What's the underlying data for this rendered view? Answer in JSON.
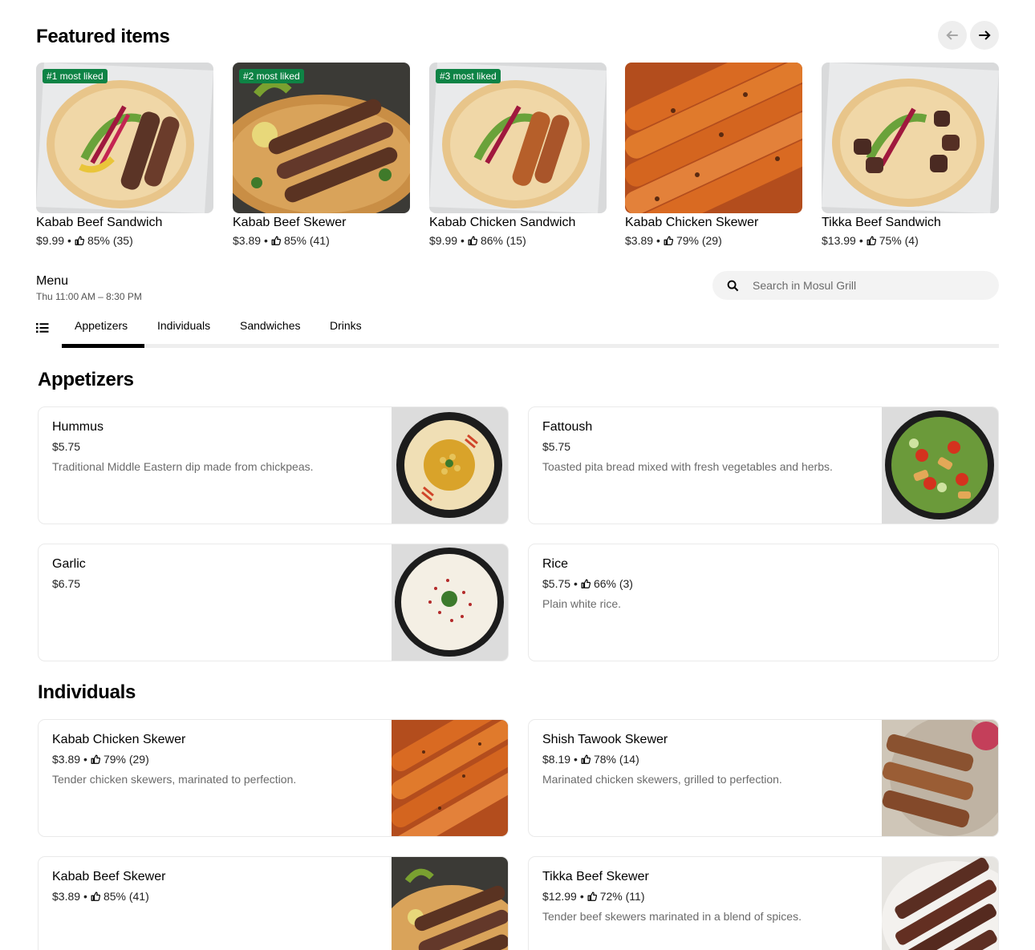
{
  "featured": {
    "title": "Featured items",
    "items": [
      {
        "badge": "#1 most liked",
        "name": "Kabab Beef Sandwich",
        "price": "$9.99",
        "rating": "85% (35)"
      },
      {
        "badge": "#2 most liked",
        "name": "Kabab Beef Skewer",
        "price": "$3.89",
        "rating": "85% (41)"
      },
      {
        "badge": "#3 most liked",
        "name": "Kabab Chicken Sandwich",
        "price": "$9.99",
        "rating": "86% (15)"
      },
      {
        "badge": "",
        "name": "Kabab Chicken Skewer",
        "price": "$3.89",
        "rating": "79% (29)"
      },
      {
        "badge": "",
        "name": "Tikka Beef Sandwich",
        "price": "$13.99",
        "rating": "75% (4)"
      }
    ]
  },
  "menu": {
    "title": "Menu",
    "hours": "Thu 11:00 AM – 8:30 PM"
  },
  "search": {
    "placeholder": "Search in Mosul Grill"
  },
  "tabs": [
    "Appetizers",
    "Individuals",
    "Sandwiches",
    "Drinks"
  ],
  "sections": {
    "appetizers": {
      "title": "Appetizers",
      "items": [
        {
          "name": "Hummus",
          "price": "$5.75",
          "rating": "",
          "desc": "Traditional Middle Eastern dip made from chickpeas."
        },
        {
          "name": "Fattoush",
          "price": "$5.75",
          "rating": "",
          "desc": "Toasted pita bread mixed with fresh vegetables and herbs."
        },
        {
          "name": "Garlic",
          "price": "$6.75",
          "rating": "",
          "desc": ""
        },
        {
          "name": "Rice",
          "price": "$5.75",
          "rating": "66% (3)",
          "desc": "Plain white rice."
        }
      ]
    },
    "individuals": {
      "title": "Individuals",
      "items": [
        {
          "name": "Kabab Chicken Skewer",
          "price": "$3.89",
          "rating": "79% (29)",
          "desc": "Tender chicken skewers, marinated to perfection."
        },
        {
          "name": "Shish Tawook Skewer",
          "price": "$8.19",
          "rating": "78% (14)",
          "desc": "Marinated chicken skewers, grilled to perfection."
        },
        {
          "name": "Kabab Beef Skewer",
          "price": "$3.89",
          "rating": "85% (41)",
          "desc": ""
        },
        {
          "name": "Tikka Beef Skewer",
          "price": "$12.99",
          "rating": "72% (11)",
          "desc": "Tender beef skewers marinated in a blend of spices."
        }
      ]
    }
  },
  "colors": {
    "badge": "#0e8345",
    "tab_indicator": "#000000",
    "muted_text": "#6b6b6b"
  },
  "icons": [
    "arrow-left-icon",
    "arrow-right-icon",
    "search-icon",
    "list-icon",
    "thumbs-up-icon"
  ]
}
